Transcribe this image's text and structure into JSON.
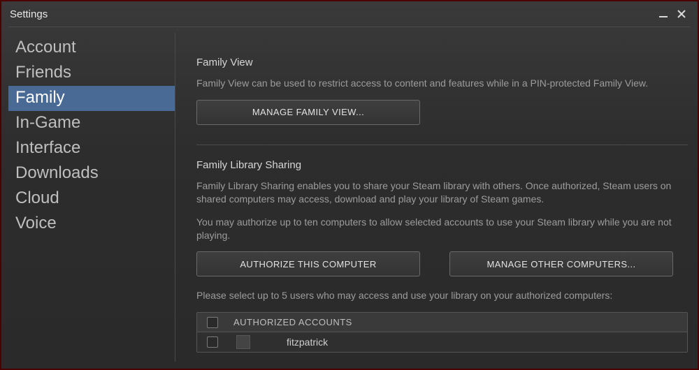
{
  "window": {
    "title": "Settings"
  },
  "sidebar": {
    "items": [
      {
        "label": "Account"
      },
      {
        "label": "Friends"
      },
      {
        "label": "Family"
      },
      {
        "label": "In-Game"
      },
      {
        "label": "Interface"
      },
      {
        "label": "Downloads"
      },
      {
        "label": "Cloud"
      },
      {
        "label": "Voice"
      }
    ],
    "selected_index": 2
  },
  "family_view": {
    "title": "Family View",
    "description": "Family View can be used to restrict access to content and features while in a PIN-protected Family View.",
    "manage_button": "MANAGE FAMILY VIEW..."
  },
  "library_sharing": {
    "title": "Family Library Sharing",
    "description1": "Family Library Sharing enables you to share your Steam library with others. Once authorized, Steam users on shared computers may access, download and play your library of Steam games.",
    "description2": "You may authorize up to ten computers to allow selected accounts to use your Steam library while you are not playing.",
    "authorize_button": "AUTHORIZE THIS COMPUTER",
    "manage_button": "MANAGE OTHER COMPUTERS...",
    "select_prompt": "Please select up to 5 users who may access and use your library on your authorized computers:",
    "table": {
      "header": "AUTHORIZED ACCOUNTS",
      "rows": [
        {
          "name": "fitzpatrick"
        }
      ]
    }
  }
}
